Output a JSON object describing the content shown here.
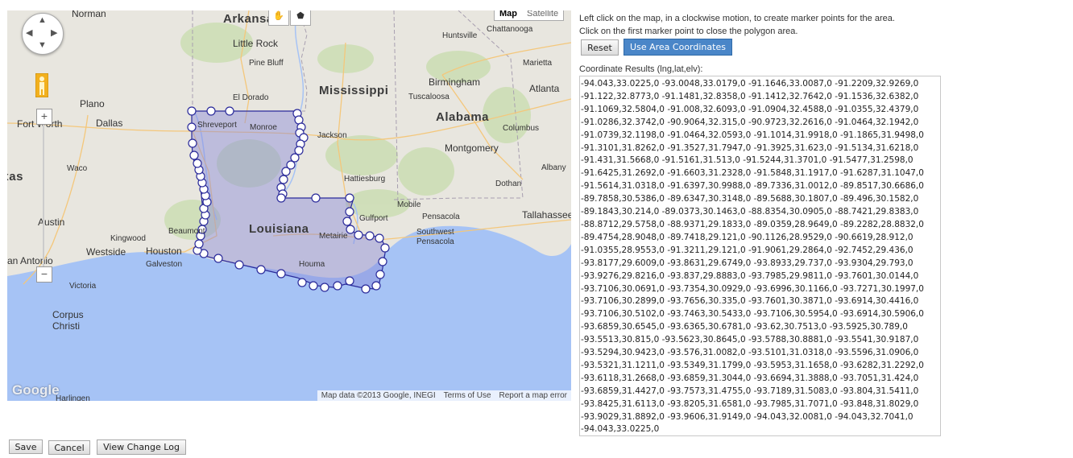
{
  "map": {
    "type_control": {
      "map": "Map",
      "satellite": "Satellite"
    },
    "zoom": {
      "in": "+",
      "out": "−"
    },
    "footer": {
      "data": "Map data ©2013 Google, INEGI",
      "terms": "Terms of Use",
      "report": "Report a map error"
    },
    "google_logo": "Google",
    "states": [
      "Arkansas",
      "Mississippi",
      "Alabama",
      "Louisiana"
    ],
    "cities": [
      "Norman",
      "Little Rock",
      "Pine Bluff",
      "El Dorado",
      "Huntsville",
      "Chattanooga",
      "Birmingham",
      "Marietta",
      "Atlanta",
      "Tuscaloosa",
      "Plano",
      "Fort Worth",
      "Dallas",
      "Shreveport",
      "Monroe",
      "Jackson",
      "Columbus",
      "Montgomery",
      "Albany",
      "Waco",
      "Hattiesburg",
      "Dothan",
      "Mobile",
      "Pensacola",
      "Tallahassee",
      "Austin",
      "Gulfport",
      "Southwest Pensacola",
      "Kingwood",
      "Beaumont",
      "Metairie",
      "Westside",
      "Houston",
      "San Antonio",
      "Galveston",
      "Houma",
      "Victoria",
      "Corpus Christi",
      "Harlingen",
      "Texas"
    ]
  },
  "instructions": {
    "line1": "Left click on the map, in a clockwise motion, to create marker points for the area.",
    "line2": "Click on the first marker point to close the polygon area."
  },
  "buttons": {
    "reset": "Reset",
    "use_coords": "Use Area Coordinates",
    "save": "Save",
    "cancel": "Cancel",
    "change_log": "View Change Log"
  },
  "results": {
    "label": "Coordinate Results (lng,lat,elv):",
    "value": "-94.043,33.0225,0 -93.0048,33.0179,0 -91.1646,33.0087,0 -91.2209,32.9269,0\n-91.122,32.8773,0 -91.1481,32.8358,0 -91.1412,32.7642,0 -91.1536,32.6382,0\n-91.1069,32.5804,0 -91.008,32.6093,0 -91.0904,32.4588,0 -91.0355,32.4379,0\n-91.0286,32.3742,0 -90.9064,32.315,0 -90.9723,32.2616,0 -91.0464,32.1942,0\n-91.0739,32.1198,0 -91.0464,32.0593,0 -91.1014,31.9918,0 -91.1865,31.9498,0\n-91.3101,31.8262,0 -91.3527,31.7947,0 -91.3925,31.623,0 -91.5134,31.6218,0\n-91.431,31.5668,0 -91.5161,31.513,0 -91.5244,31.3701,0 -91.5477,31.2598,0\n-91.6425,31.2692,0 -91.6603,31.2328,0 -91.5848,31.1917,0 -91.6287,31.1047,0\n-91.5614,31.0318,0 -91.6397,30.9988,0 -89.7336,31.0012,0 -89.8517,30.6686,0\n-89.7858,30.5386,0 -89.6347,30.3148,0 -89.5688,30.1807,0 -89.496,30.1582,0\n-89.1843,30.214,0 -89.0373,30.1463,0 -88.8354,30.0905,0 -88.7421,29.8383,0\n-88.8712,29.5758,0 -88.9371,29.1833,0 -89.0359,28.9649,0 -89.2282,28.8832,0\n-89.4754,28.9048,0 -89.7418,29.121,0 -90.1126,28.9529,0 -90.6619,28.912,0\n-91.0355,28.9553,0 -91.3211,29.121,0 -91.9061,29.2864,0 -92.7452,29.436,0\n-93.8177,29.6009,0 -93.8631,29.6749,0 -93.8933,29.737,0 -93.9304,29.793,0\n-93.9276,29.8216,0 -93.837,29.8883,0 -93.7985,29.9811,0 -93.7601,30.0144,0\n-93.7106,30.0691,0 -93.7354,30.0929,0 -93.6996,30.1166,0 -93.7271,30.1997,0\n-93.7106,30.2899,0 -93.7656,30.335,0 -93.7601,30.3871,0 -93.6914,30.4416,0\n-93.7106,30.5102,0 -93.7463,30.5433,0 -93.7106,30.5954,0 -93.6914,30.5906,0\n-93.6859,30.6545,0 -93.6365,30.6781,0 -93.62,30.7513,0 -93.5925,30.789,0\n-93.5513,30.815,0 -93.5623,30.8645,0 -93.5788,30.8881,0 -93.5541,30.9187,0\n-93.5294,30.9423,0 -93.576,31.0082,0 -93.5101,31.0318,0 -93.5596,31.0906,0\n-93.5321,31.1211,0 -93.5349,31.1799,0 -93.5953,31.1658,0 -93.6282,31.2292,0\n-93.6118,31.2668,0 -93.6859,31.3044,0 -93.6694,31.3888,0 -93.7051,31.424,0\n-93.6859,31.4427,0 -93.7573,31.4755,0 -93.7189,31.5083,0 -93.804,31.5411,0\n-93.8425,31.6113,0 -93.8205,31.6581,0 -93.7985,31.7071,0 -93.848,31.8029,0\n-93.9029,31.8892,0 -93.9606,31.9149,0 -94.043,32.0081,0 -94.043,32.7041,0\n-94.043,33.0225,0"
  },
  "colors": {
    "land": "#e8e6df",
    "water": "#a6c3f5",
    "polygon_fill": "#8a8ad9",
    "polygon_stroke": "#2a2a9a",
    "primary_button": "#4a86c8"
  }
}
